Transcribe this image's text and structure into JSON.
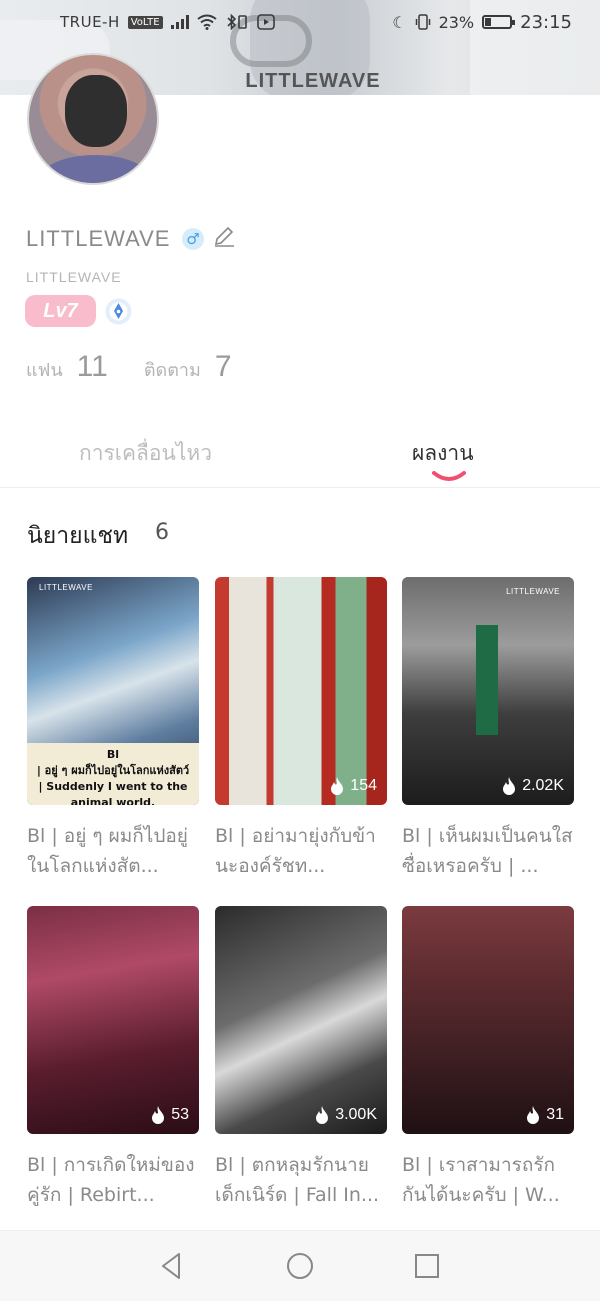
{
  "status_bar": {
    "carrier": "TRUE-H",
    "volte": "VoLTE",
    "battery_percent": "23%",
    "battery_level": 0.23,
    "time": "23:15"
  },
  "header": {
    "title": "LITTLEWAVE"
  },
  "profile": {
    "display_name": "LITTLEWAVE",
    "username": "LITTLEWAVE",
    "gender_symbol": "♂",
    "level": "Lv7",
    "fans_label": "แฟน",
    "fans_count": "11",
    "following_label": "ติดตาม",
    "following_count": "7"
  },
  "tabs": {
    "activity": "การเคลื่อนไหว",
    "works": "ผลงาน",
    "active": "works"
  },
  "section": {
    "title": "นิยายแชท",
    "count": "6"
  },
  "stories": [
    {
      "title": "Bl | อยู่ ๆ ผมก็ไปอยู่ในโลกแห่งสัต...",
      "cover_tag": "LITTLEWAVE",
      "cover_caption": "Bl\n| อยู่ ๆ ผมก็ไปอยู่ในโลกแห่งสัตว์\n| Suddenly I went to the animal world.",
      "views": ""
    },
    {
      "title": "Bl | อย่ามายุ่งกับข้านะองค์รัชท...",
      "cover_tag": "",
      "cover_caption": "",
      "views": "154"
    },
    {
      "title": "Bl | เห็นผมเป็นคนใสซื่อเหรอครับ | ...",
      "cover_tag": "LITTLEWAVE",
      "cover_caption": "",
      "views": "2.02K"
    },
    {
      "title": "Bl | การเกิดใหม่ของคู่รัก | Rebirt...",
      "cover_tag": "",
      "cover_caption": "",
      "views": "53"
    },
    {
      "title": "Bl | ตกหลุมรักนายเด็กเนิร์ด | Fall In...",
      "cover_tag": "",
      "cover_caption": "",
      "views": "3.00K"
    },
    {
      "title": "Bl | เราสามารถรักกันได้นะครับ | W...",
      "cover_tag": "",
      "cover_caption": "",
      "views": "31"
    }
  ],
  "colors": {
    "accent": "#f0506e",
    "level_badge": "#f8bccc",
    "gender": "#3fa2ea"
  },
  "icons": {
    "back": "back-arrow-icon",
    "gender": "male-icon",
    "edit": "pencil-icon",
    "badge": "pen-nib-badge-icon",
    "views": "flame-icon",
    "nav_back": "triangle-back-icon",
    "nav_home": "circle-home-icon",
    "nav_recent": "square-recents-icon"
  }
}
